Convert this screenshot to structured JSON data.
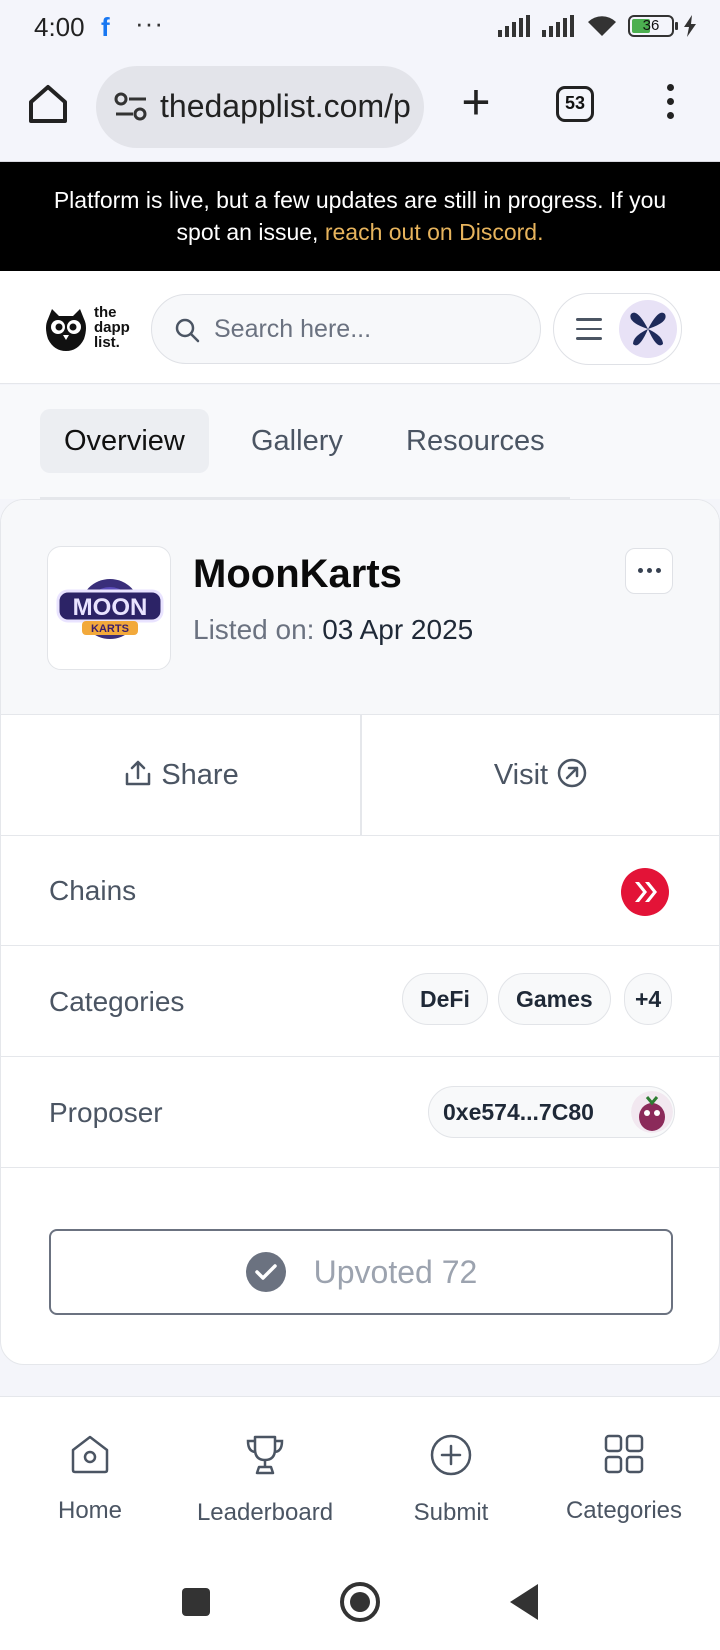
{
  "status_bar": {
    "time": "4:00",
    "app_icons": [
      "facebook-icon",
      "more-dots-icon"
    ],
    "more": "···",
    "battery": "36"
  },
  "browser": {
    "url": "thedapplist.com/p",
    "tab_count": "53"
  },
  "announcement": {
    "text": "Platform is live, but a few updates are still in progress. If you spot an issue,",
    "link": "reach out on Discord."
  },
  "header": {
    "logo_lines": [
      "the",
      "dapp",
      "list."
    ],
    "search_placeholder": "Search here..."
  },
  "tabs": [
    "Overview",
    "Gallery",
    "Resources"
  ],
  "app": {
    "name": "MoonKarts",
    "listed_label": "Listed on:",
    "listed_date": "03 Apr 2025",
    "logo_text": [
      "MOON",
      "KARTS"
    ]
  },
  "actions": {
    "share": "Share",
    "visit": "Visit"
  },
  "details": {
    "chains_label": "Chains",
    "categories_label": "Categories",
    "categories": [
      "DeFi",
      "Games",
      "+4"
    ],
    "proposer_label": "Proposer",
    "proposer_address": "0xe574...7C80"
  },
  "upvote": {
    "label": "Upvoted 72"
  },
  "bottom_nav": [
    "Home",
    "Leaderboard",
    "Submit",
    "Categories"
  ],
  "colors": {
    "announcement_link": "#e7b45d",
    "chain_badge": "#e31337",
    "avatar_bg": "#e8e2f6"
  }
}
